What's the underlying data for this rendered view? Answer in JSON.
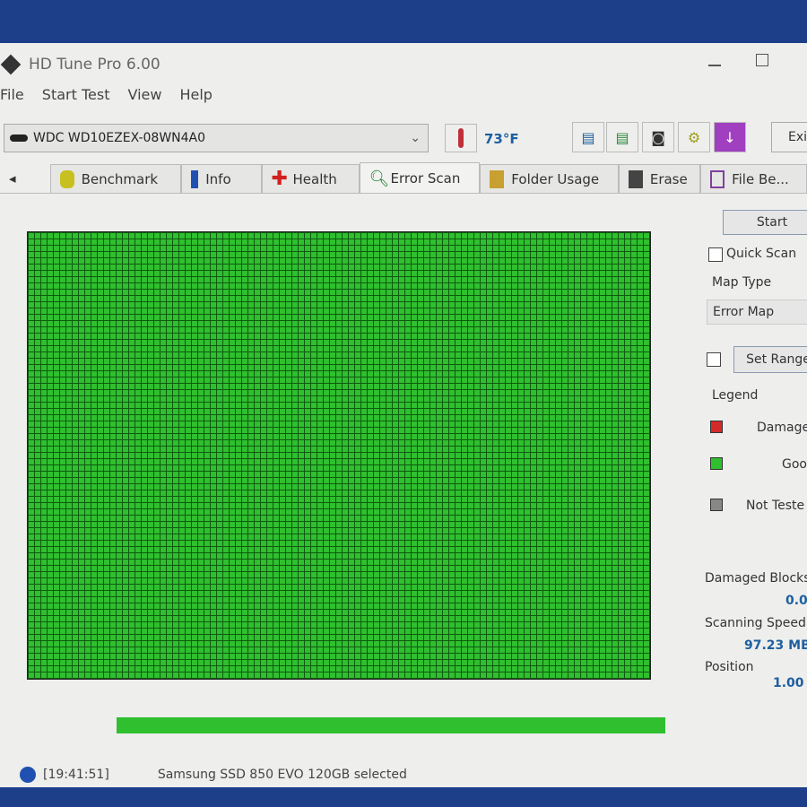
{
  "window": {
    "title": "HD Tune Pro 6.00"
  },
  "menu": [
    "File",
    "Start Test",
    "View",
    "Help"
  ],
  "drive": {
    "selected": "WDC WD10EZEX-08WN4A0"
  },
  "temperature": "73°F",
  "toolbar": {
    "exit_label": "Exi"
  },
  "tabs": [
    "Benchmark",
    "Info",
    "Health",
    "Error Scan",
    "Folder Usage",
    "Erase",
    "File Be..."
  ],
  "active_tab": "Error Scan",
  "error_map": {
    "blocks_state": "all good",
    "colors": {
      "good": "#2fbf2f",
      "damaged": "#d42a2a",
      "not_tested": "#888888"
    }
  },
  "scan_progress_percent": 100,
  "side": {
    "start_label": "Start",
    "quick_scan_label": "Quick Scan",
    "quick_scan_checked": false,
    "map_type_label": "Map Type",
    "map_type_value": "Error Map",
    "set_range_label": "Set Range",
    "set_range_checked": false,
    "legend_label": "Legend",
    "legend": [
      "Damage",
      "Goo",
      "Not Teste"
    ],
    "damaged_blocks_label": "Damaged Blocks",
    "damaged_blocks_value": "0.0",
    "scanning_speed_label": "Scanning Speed",
    "scanning_speed_value": "97.23 MB",
    "position_label": "Position",
    "position_value": "1.00"
  },
  "status": {
    "time": "[19:41:51]",
    "message": "Samsung SSD 850 EVO 120GB selected"
  }
}
